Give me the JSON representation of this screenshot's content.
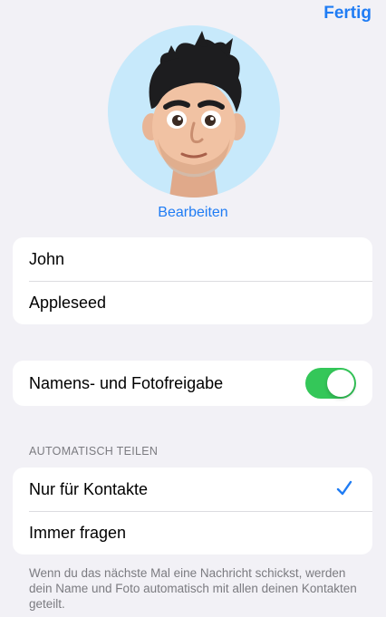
{
  "header": {
    "done_label": "Fertig"
  },
  "profile": {
    "edit_label": "Bearbeiten",
    "avatar_bg": "#c7e9fb"
  },
  "name_fields": {
    "first_name": "John",
    "last_name": "Appleseed"
  },
  "sharing": {
    "label": "Namens- und Fotofreigabe",
    "enabled": true,
    "toggle_color": "#34c759"
  },
  "auto_share": {
    "header": "AUTOMATISCH TEILEN",
    "options": [
      {
        "label": "Nur für Kontakte",
        "selected": true
      },
      {
        "label": "Immer fragen",
        "selected": false
      }
    ],
    "footer": "Wenn du das nächste Mal eine Nachricht schickst, werden dein Name und Foto automatisch mit allen deinen Kontakten geteilt."
  },
  "colors": {
    "accent": "#1f7cf4",
    "background": "#f2f1f6"
  }
}
